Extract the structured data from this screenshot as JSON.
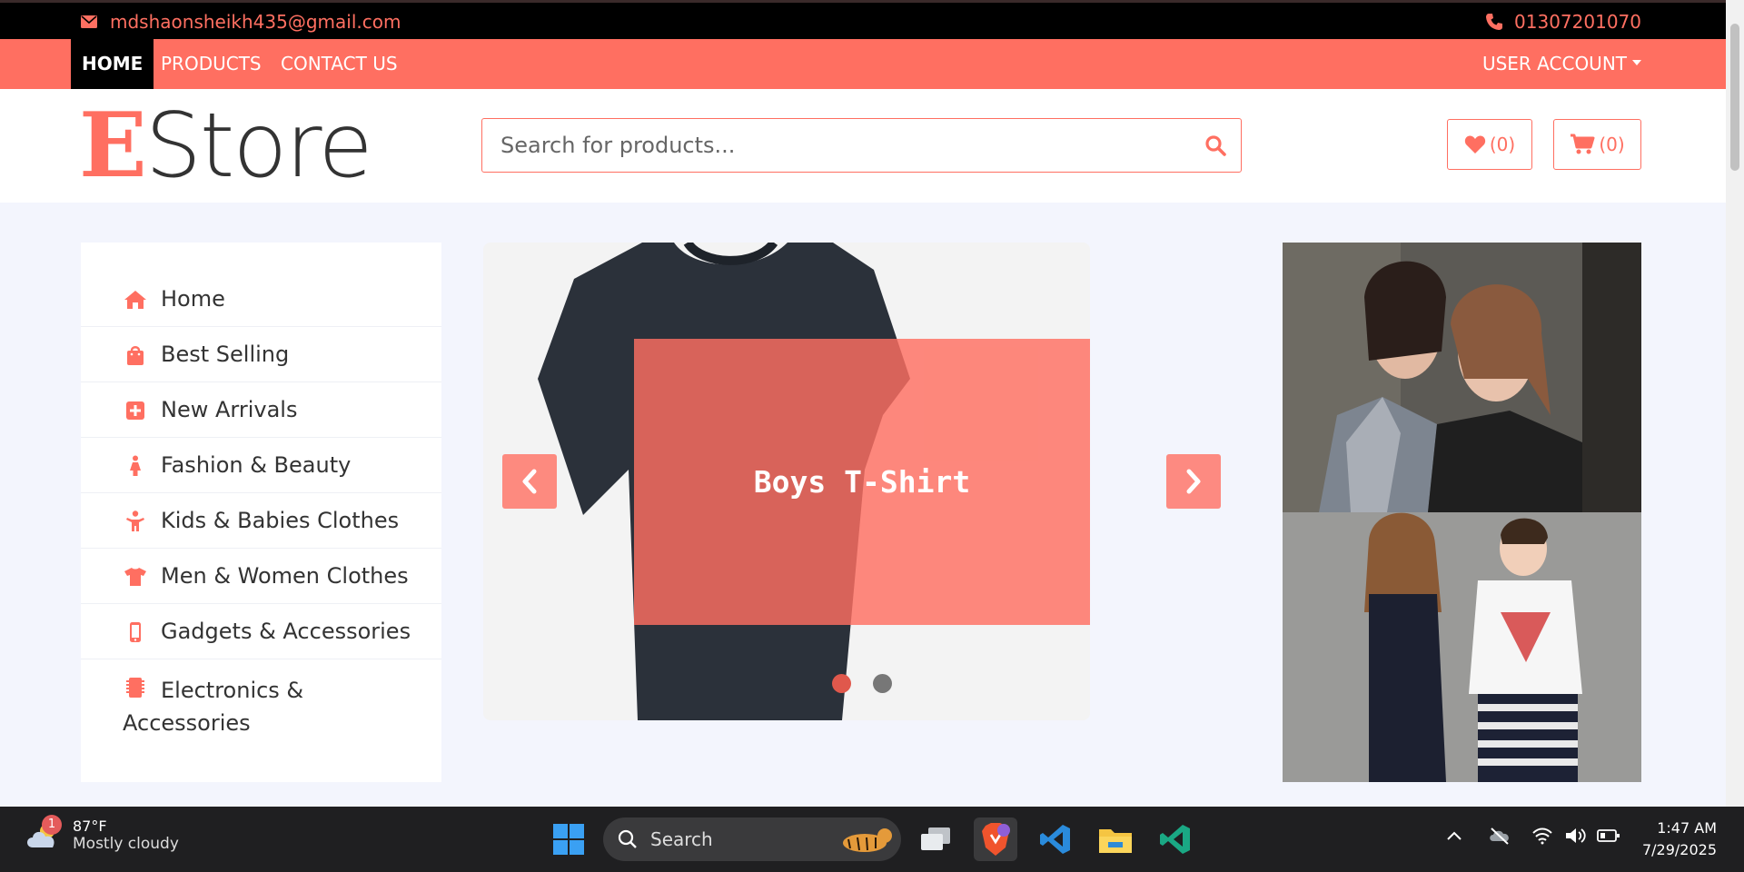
{
  "topbar": {
    "email": "mdshaonsheikh435@gmail.com",
    "phone": "01307201070"
  },
  "nav": {
    "home": "HOME",
    "products": "PRODUCTS",
    "contact": "CONTACT US",
    "account": "USER ACCOUNT"
  },
  "header": {
    "logo_first": "E",
    "logo_rest": "Store",
    "search_placeholder": "Search for products...",
    "wishlist_count": "(0)",
    "cart_count": "(0)"
  },
  "sidebar": {
    "items": [
      {
        "label": "Home",
        "icon": "home-icon"
      },
      {
        "label": "Best Selling",
        "icon": "shopping-bag-icon"
      },
      {
        "label": "New Arrivals",
        "icon": "plus-square-icon"
      },
      {
        "label": "Fashion & Beauty",
        "icon": "female-icon"
      },
      {
        "label": "Kids & Babies Clothes",
        "icon": "child-icon"
      },
      {
        "label": "Men & Women Clothes",
        "icon": "tshirt-icon"
      },
      {
        "label": "Gadgets & Accessories",
        "icon": "mobile-icon"
      },
      {
        "label": "Electronics & Accessories",
        "icon": "microchip-icon"
      }
    ]
  },
  "carousel": {
    "caption": "Boys T-Shirt",
    "slides": 2,
    "active_slide": 1
  },
  "colors": {
    "accent": "#ff6f61",
    "topbar": "#000000",
    "page_bg": "#f3f5fd"
  },
  "taskbar": {
    "weather_badge": "1",
    "temperature": "87°F",
    "condition": "Mostly cloudy",
    "search_label": "Search",
    "time": "1:47 AM",
    "date": "7/29/2025"
  }
}
